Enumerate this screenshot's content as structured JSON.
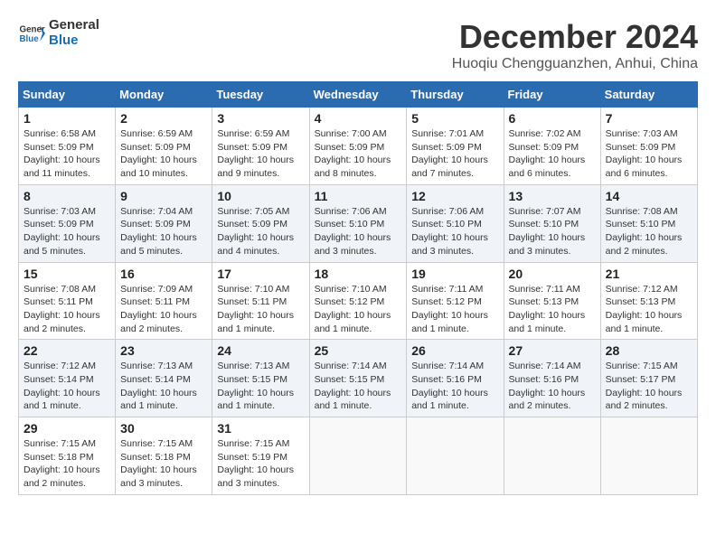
{
  "header": {
    "logo_line1": "General",
    "logo_line2": "Blue",
    "month_title": "December 2024",
    "location": "Huoqiu Chengguanzhen, Anhui, China"
  },
  "weekdays": [
    "Sunday",
    "Monday",
    "Tuesday",
    "Wednesday",
    "Thursday",
    "Friday",
    "Saturday"
  ],
  "weeks": [
    [
      {
        "day": "1",
        "info": "Sunrise: 6:58 AM\nSunset: 5:09 PM\nDaylight: 10 hours\nand 11 minutes."
      },
      {
        "day": "2",
        "info": "Sunrise: 6:59 AM\nSunset: 5:09 PM\nDaylight: 10 hours\nand 10 minutes."
      },
      {
        "day": "3",
        "info": "Sunrise: 6:59 AM\nSunset: 5:09 PM\nDaylight: 10 hours\nand 9 minutes."
      },
      {
        "day": "4",
        "info": "Sunrise: 7:00 AM\nSunset: 5:09 PM\nDaylight: 10 hours\nand 8 minutes."
      },
      {
        "day": "5",
        "info": "Sunrise: 7:01 AM\nSunset: 5:09 PM\nDaylight: 10 hours\nand 7 minutes."
      },
      {
        "day": "6",
        "info": "Sunrise: 7:02 AM\nSunset: 5:09 PM\nDaylight: 10 hours\nand 6 minutes."
      },
      {
        "day": "7",
        "info": "Sunrise: 7:03 AM\nSunset: 5:09 PM\nDaylight: 10 hours\nand 6 minutes."
      }
    ],
    [
      {
        "day": "8",
        "info": "Sunrise: 7:03 AM\nSunset: 5:09 PM\nDaylight: 10 hours\nand 5 minutes."
      },
      {
        "day": "9",
        "info": "Sunrise: 7:04 AM\nSunset: 5:09 PM\nDaylight: 10 hours\nand 5 minutes."
      },
      {
        "day": "10",
        "info": "Sunrise: 7:05 AM\nSunset: 5:09 PM\nDaylight: 10 hours\nand 4 minutes."
      },
      {
        "day": "11",
        "info": "Sunrise: 7:06 AM\nSunset: 5:10 PM\nDaylight: 10 hours\nand 3 minutes."
      },
      {
        "day": "12",
        "info": "Sunrise: 7:06 AM\nSunset: 5:10 PM\nDaylight: 10 hours\nand 3 minutes."
      },
      {
        "day": "13",
        "info": "Sunrise: 7:07 AM\nSunset: 5:10 PM\nDaylight: 10 hours\nand 3 minutes."
      },
      {
        "day": "14",
        "info": "Sunrise: 7:08 AM\nSunset: 5:10 PM\nDaylight: 10 hours\nand 2 minutes."
      }
    ],
    [
      {
        "day": "15",
        "info": "Sunrise: 7:08 AM\nSunset: 5:11 PM\nDaylight: 10 hours\nand 2 minutes."
      },
      {
        "day": "16",
        "info": "Sunrise: 7:09 AM\nSunset: 5:11 PM\nDaylight: 10 hours\nand 2 minutes."
      },
      {
        "day": "17",
        "info": "Sunrise: 7:10 AM\nSunset: 5:11 PM\nDaylight: 10 hours\nand 1 minute."
      },
      {
        "day": "18",
        "info": "Sunrise: 7:10 AM\nSunset: 5:12 PM\nDaylight: 10 hours\nand 1 minute."
      },
      {
        "day": "19",
        "info": "Sunrise: 7:11 AM\nSunset: 5:12 PM\nDaylight: 10 hours\nand 1 minute."
      },
      {
        "day": "20",
        "info": "Sunrise: 7:11 AM\nSunset: 5:13 PM\nDaylight: 10 hours\nand 1 minute."
      },
      {
        "day": "21",
        "info": "Sunrise: 7:12 AM\nSunset: 5:13 PM\nDaylight: 10 hours\nand 1 minute."
      }
    ],
    [
      {
        "day": "22",
        "info": "Sunrise: 7:12 AM\nSunset: 5:14 PM\nDaylight: 10 hours\nand 1 minute."
      },
      {
        "day": "23",
        "info": "Sunrise: 7:13 AM\nSunset: 5:14 PM\nDaylight: 10 hours\nand 1 minute."
      },
      {
        "day": "24",
        "info": "Sunrise: 7:13 AM\nSunset: 5:15 PM\nDaylight: 10 hours\nand 1 minute."
      },
      {
        "day": "25",
        "info": "Sunrise: 7:14 AM\nSunset: 5:15 PM\nDaylight: 10 hours\nand 1 minute."
      },
      {
        "day": "26",
        "info": "Sunrise: 7:14 AM\nSunset: 5:16 PM\nDaylight: 10 hours\nand 1 minute."
      },
      {
        "day": "27",
        "info": "Sunrise: 7:14 AM\nSunset: 5:16 PM\nDaylight: 10 hours\nand 2 minutes."
      },
      {
        "day": "28",
        "info": "Sunrise: 7:15 AM\nSunset: 5:17 PM\nDaylight: 10 hours\nand 2 minutes."
      }
    ],
    [
      {
        "day": "29",
        "info": "Sunrise: 7:15 AM\nSunset: 5:18 PM\nDaylight: 10 hours\nand 2 minutes."
      },
      {
        "day": "30",
        "info": "Sunrise: 7:15 AM\nSunset: 5:18 PM\nDaylight: 10 hours\nand 3 minutes."
      },
      {
        "day": "31",
        "info": "Sunrise: 7:15 AM\nSunset: 5:19 PM\nDaylight: 10 hours\nand 3 minutes."
      },
      {
        "day": "",
        "info": ""
      },
      {
        "day": "",
        "info": ""
      },
      {
        "day": "",
        "info": ""
      },
      {
        "day": "",
        "info": ""
      }
    ]
  ]
}
